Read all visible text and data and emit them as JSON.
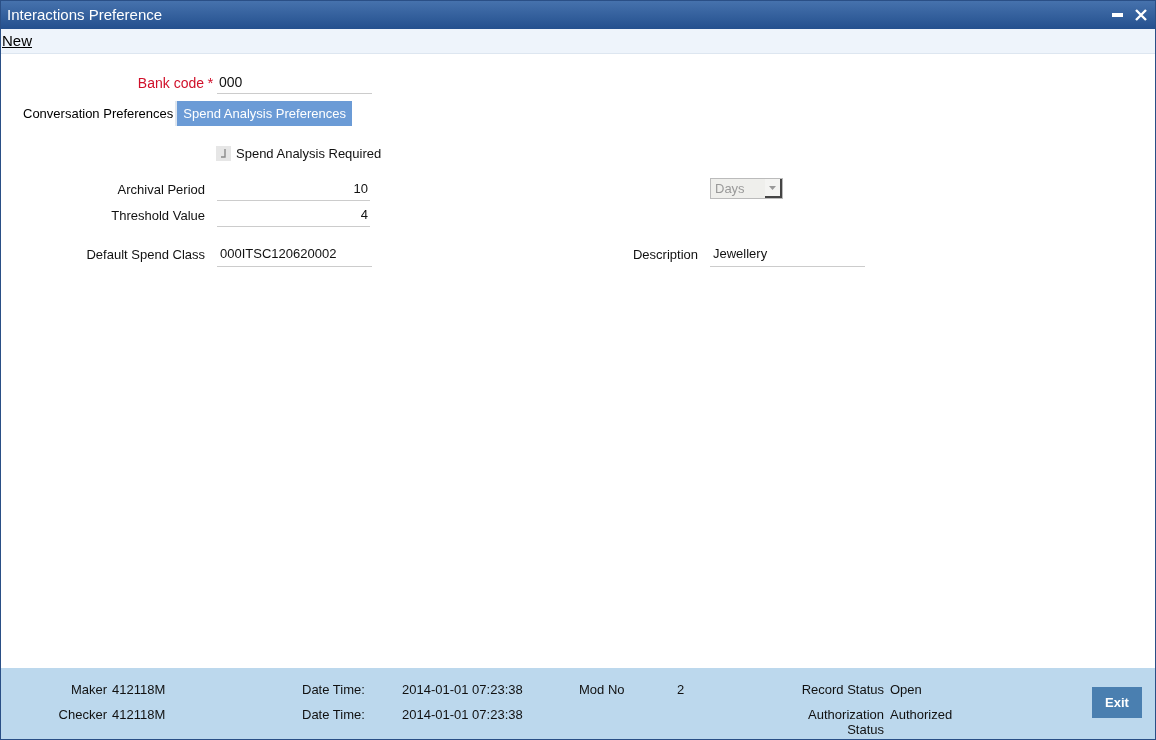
{
  "window": {
    "title": "Interactions Preference"
  },
  "menu": [
    "New"
  ],
  "bank_code": {
    "label": "Bank code",
    "required_marker": "*",
    "value": "000"
  },
  "tabs": [
    {
      "label": "Conversation Preferences",
      "selected": false
    },
    {
      "label": "Spend Analysis Preferences",
      "selected": true
    }
  ],
  "spend_analysis_required": {
    "label": "Spend Analysis Required",
    "checked": true,
    "disabled": true
  },
  "archival_period": {
    "label": "Archival Period",
    "value": "10",
    "unit": "Days"
  },
  "threshold_value": {
    "label": "Threshold Value",
    "value": "4"
  },
  "default_spend_class": {
    "label": "Default Spend Class",
    "value": "000ITSC120620002"
  },
  "description": {
    "label": "Description",
    "value": "Jewellery"
  },
  "status_bar": {
    "maker": {
      "label": "Maker",
      "value": "412118M"
    },
    "maker_date": {
      "label": "Date Time:",
      "value": "2014-01-01 07:23:38"
    },
    "mod_no": {
      "label": "Mod No",
      "value": "2"
    },
    "record_status": {
      "label": "Record Status",
      "value": "Open"
    },
    "checker": {
      "label": "Checker",
      "value": "412118M"
    },
    "checker_date": {
      "label": "Date Time:",
      "value": "2014-01-01 07:23:38"
    },
    "authorization_status": {
      "label": "Authorization Status",
      "value": "Authorized"
    }
  },
  "buttons": [
    "Exit"
  ]
}
